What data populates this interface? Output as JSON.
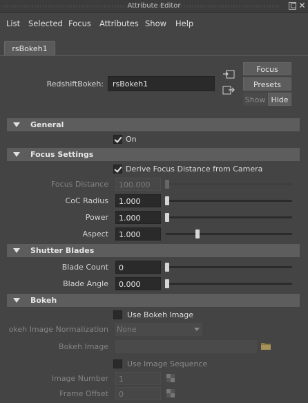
{
  "window": {
    "title": "Attribute Editor"
  },
  "menu": [
    "List",
    "Selected",
    "Focus",
    "Attributes",
    "Show",
    "Help"
  ],
  "tab": {
    "label": "rsBokeh1"
  },
  "node": {
    "type_label": "RedshiftBokeh:",
    "name": "rsBokeh1"
  },
  "buttons": {
    "focus": "Focus",
    "presets": "Presets",
    "show": "Show",
    "hide": "Hide"
  },
  "sections": {
    "general": {
      "title": "General",
      "on_label": "On",
      "on_checked": true
    },
    "focus_settings": {
      "title": "Focus Settings",
      "derive_label": "Derive Focus Distance from Camera",
      "derive_checked": true,
      "focus_distance": {
        "label": "Focus Distance",
        "value": "100.000",
        "enabled": false,
        "slider": 0.0
      },
      "coc_radius": {
        "label": "CoC Radius",
        "value": "1.000",
        "slider": 0.0
      },
      "power": {
        "label": "Power",
        "value": "1.000",
        "slider": 0.0
      },
      "aspect": {
        "label": "Aspect",
        "value": "1.000",
        "slider": 0.25
      }
    },
    "shutter_blades": {
      "title": "Shutter Blades",
      "blade_count": {
        "label": "Blade Count",
        "value": "0",
        "slider": 0.0
      },
      "blade_angle": {
        "label": "Blade Angle",
        "value": "0.000",
        "slider": 0.0
      }
    },
    "bokeh": {
      "title": "Bokeh",
      "use_image_label": "Use Bokeh Image",
      "use_image_checked": false,
      "normalization": {
        "label": "okeh Image Normalization",
        "value": "None"
      },
      "bokeh_image": {
        "label": "Bokeh Image",
        "value": ""
      },
      "use_sequence_label": "Use Image Sequence",
      "use_sequence_checked": false,
      "image_number": {
        "label": "Image Number",
        "value": "1"
      },
      "frame_offset": {
        "label": "Frame Offset",
        "value": "0"
      }
    }
  },
  "colors": {
    "panel": "#444444",
    "section": "#5d5d5d",
    "field": "#2a2a2a",
    "text": "#d4d4d4"
  }
}
